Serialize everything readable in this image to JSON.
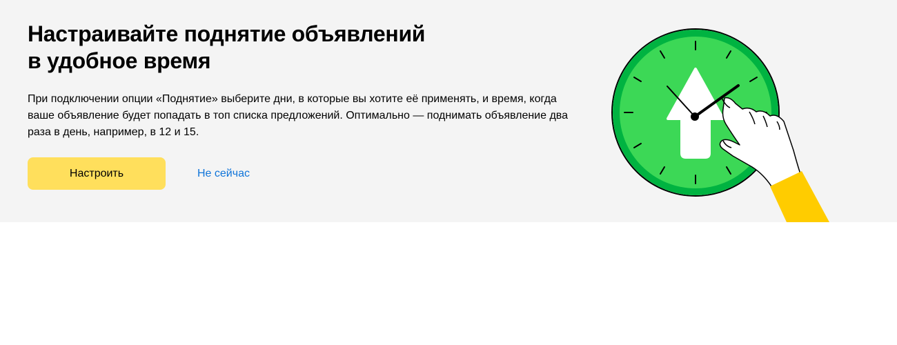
{
  "banner": {
    "title_line1": "Настраивайте поднятие объявлений",
    "title_line2": "в удобное время",
    "description": "При подключении опции «Поднятие» выберите дни, в которые вы хотите её применять, и время, когда ваше объявление будет попадать в топ списка предложений. Оптимально — поднимать объявление два раза в день, например, в 12 и 15.",
    "primary_button_label": "Настроить",
    "secondary_link_label": "Не сейчас"
  },
  "colors": {
    "banner_background": "#f4f4f4",
    "primary_button": "#ffdf5c",
    "link": "#0f74d9",
    "clock_outer": "#00b341",
    "clock_face": "#3cd856",
    "sleeve": "#ffcc00"
  },
  "illustration": {
    "icons": [
      "clock-icon",
      "up-arrow-icon",
      "pointing-hand-icon"
    ]
  }
}
